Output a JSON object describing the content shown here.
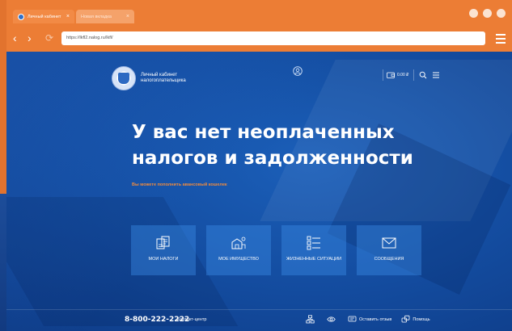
{
  "browser": {
    "tabs": [
      {
        "title": "Личный кабинет",
        "close": "×"
      },
      {
        "title": "Новая вкладка",
        "close": "×"
      }
    ],
    "url": "https://lkfl2.nalog.ru/lkfl/",
    "nav": {
      "back": "‹",
      "forward": "›",
      "reload": "⟳"
    }
  },
  "header": {
    "logo_text": "Личный кабинет налогоплательщика",
    "wallet_amount": "0.00 ₽"
  },
  "hero": {
    "headline_line1": "У вас нет неоплаченных",
    "headline_line2": "налогов и задолженности",
    "subline": "Вы можете пополнить авансовый кошелек"
  },
  "tiles": [
    {
      "label": "МОИ НАЛОГИ",
      "icon": "tax-documents-icon"
    },
    {
      "label": "МОЕ ИМУЩЕСТВО",
      "icon": "property-icon"
    },
    {
      "label": "ЖИЗНЕННЫЕ СИТУАЦИИ",
      "icon": "life-situations-icon"
    },
    {
      "label": "СООБЩЕНИЯ",
      "icon": "envelope-icon"
    }
  ],
  "footer": {
    "phone": "8-800-222-2222",
    "contact_label": "Контакт-центр",
    "feedback_label": "Оставить отзыв",
    "help_label": "Помощь"
  },
  "colors": {
    "browser_orange": "#ec7d35",
    "page_blue": "#154ea5",
    "accent_orange": "#f08b3e",
    "tile_blue": "#3c8ce6"
  }
}
